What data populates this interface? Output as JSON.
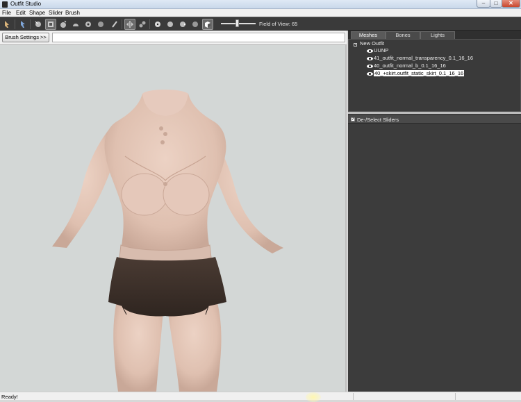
{
  "window": {
    "title": "Outfit Studio"
  },
  "menu": {
    "items": [
      "File",
      "Edit",
      "Shape",
      "Slider",
      "Brush"
    ]
  },
  "toolbar": {
    "fov_label": "Field of View: 65",
    "fov_value": 65
  },
  "viewport": {
    "brush_settings_label": "Brush Settings >>"
  },
  "right_panel": {
    "tabs": [
      "Meshes",
      "Bones",
      "Lights"
    ],
    "active_tab": "Meshes",
    "tree": {
      "root": "New Outfit",
      "items": [
        "UUNP",
        "41_outfit_normal_transparency_0.1_16_16",
        "40_outfit_normal_b_0.1_16_16",
        "40_+skirt.outfit_static_skirt_0.1_16_16"
      ],
      "selected_index": 3
    },
    "sliders": {
      "header_label": "De-/Select Sliders",
      "checked": true
    }
  },
  "statusbar": {
    "text": "Ready!"
  },
  "colors": {
    "skin": "#e3c6b6",
    "skirt": "#3b2f2a",
    "panel_dark": "#3c3c3c",
    "toolbar": "#3a3a3a"
  }
}
